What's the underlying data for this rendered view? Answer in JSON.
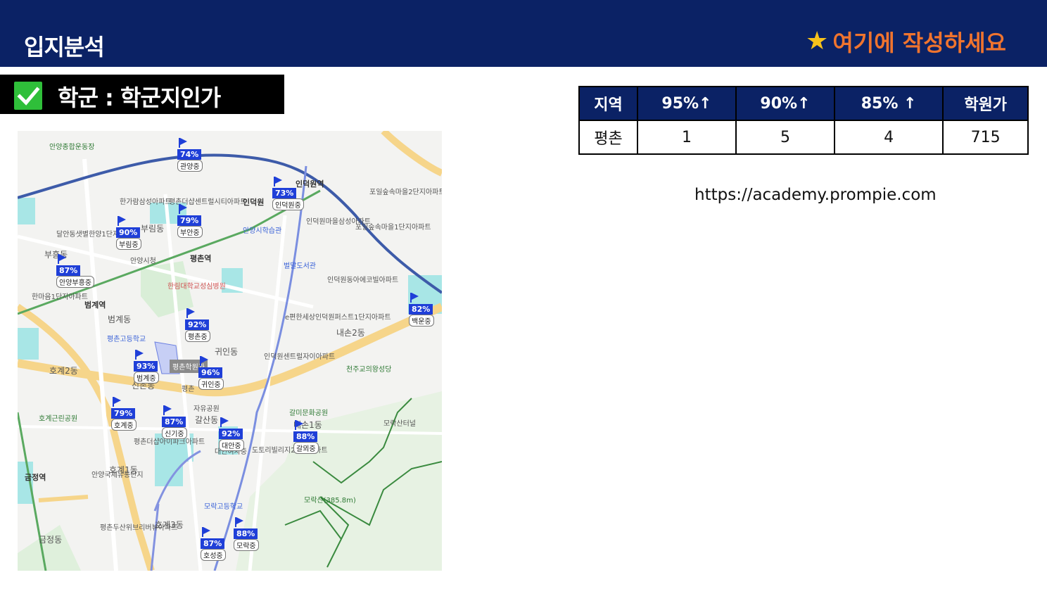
{
  "header": {
    "title": "입지분석",
    "cta_star": "★",
    "cta_text": "여기에 작성하세요"
  },
  "section": {
    "label": "학군 : 학군지인가"
  },
  "table": {
    "headers": [
      "지역",
      "95%↑",
      "90%↑",
      "85% ↑",
      "학원가"
    ],
    "rows": [
      [
        "평촌",
        "1",
        "5",
        "4",
        "715"
      ]
    ]
  },
  "url": "https://academy.prompie.com",
  "map": {
    "school_markers": [
      {
        "pct": "74%",
        "name": "관양중"
      },
      {
        "pct": "73%",
        "name": "인덕원중"
      },
      {
        "pct": "79%",
        "name": "부안중"
      },
      {
        "pct": "90%",
        "name": "부림중"
      },
      {
        "pct": "87%",
        "name": "안양부흥중"
      },
      {
        "pct": "82%",
        "name": "백운중"
      },
      {
        "pct": "92%",
        "name": "평촌중"
      },
      {
        "pct": "93%",
        "name": "범계중"
      },
      {
        "pct": "96%",
        "name": "귀인중"
      },
      {
        "pct": "79%",
        "name": "호계중"
      },
      {
        "pct": "87%",
        "name": "신기중"
      },
      {
        "pct": "92%",
        "name": "대안중"
      },
      {
        "pct": "88%",
        "name": "갈뫼중"
      },
      {
        "pct": "87%",
        "name": "호성중"
      },
      {
        "pct": "88%",
        "name": "모락중"
      }
    ],
    "place_labels": [
      {
        "text": "안양종합운동장"
      },
      {
        "text": "한가람삼성아파트"
      },
      {
        "text": "평촌더샵센트럴시티아파트"
      },
      {
        "text": "인덕원역"
      },
      {
        "text": "포일숲속마을2단지아파트"
      },
      {
        "text": "인덕원마을삼성아파트"
      },
      {
        "text": "포일숲속마을1단지아파트"
      },
      {
        "text": "부림동"
      },
      {
        "text": "인덕원"
      },
      {
        "text": "안양시학습관"
      },
      {
        "text": "달안동샛별한양1단지아파트"
      },
      {
        "text": "부흥동"
      },
      {
        "text": "안양시청"
      },
      {
        "text": "평촌역"
      },
      {
        "text": "벌말도서관"
      },
      {
        "text": "인덕원동아에코빌아파트"
      },
      {
        "text": "한마음1단지아파트"
      },
      {
        "text": "범계역"
      },
      {
        "text": "한림대학교성심병원"
      },
      {
        "text": "범계동"
      },
      {
        "text": "e편한세상인덕원퍼스트1단지아파트"
      },
      {
        "text": "내손2동"
      },
      {
        "text": "평촌고등학교"
      },
      {
        "text": "귀인동"
      },
      {
        "text": "인덕원센트럴자이아파트"
      },
      {
        "text": "천주교의왕성당"
      },
      {
        "text": "호계2동"
      },
      {
        "text": "평촌학원가"
      },
      {
        "text": "신촌동"
      },
      {
        "text": "평촌"
      },
      {
        "text": "호계근린공원"
      },
      {
        "text": "자유공원"
      },
      {
        "text": "갈미문화공원"
      },
      {
        "text": "갈산동"
      },
      {
        "text": "내손1동"
      },
      {
        "text": "모락산터널"
      },
      {
        "text": "평촌더샵아이파크아파트"
      },
      {
        "text": "대안여자중"
      },
      {
        "text": "도토리빌리지2단지아파트"
      },
      {
        "text": "호계1동"
      },
      {
        "text": "금정역"
      },
      {
        "text": "안양국제유통단지"
      },
      {
        "text": "모락산(385.8m)"
      },
      {
        "text": "모락고등학교"
      },
      {
        "text": "호계3동"
      },
      {
        "text": "평촌두산위브리버뷰아파트"
      },
      {
        "text": "금정동"
      }
    ]
  }
}
